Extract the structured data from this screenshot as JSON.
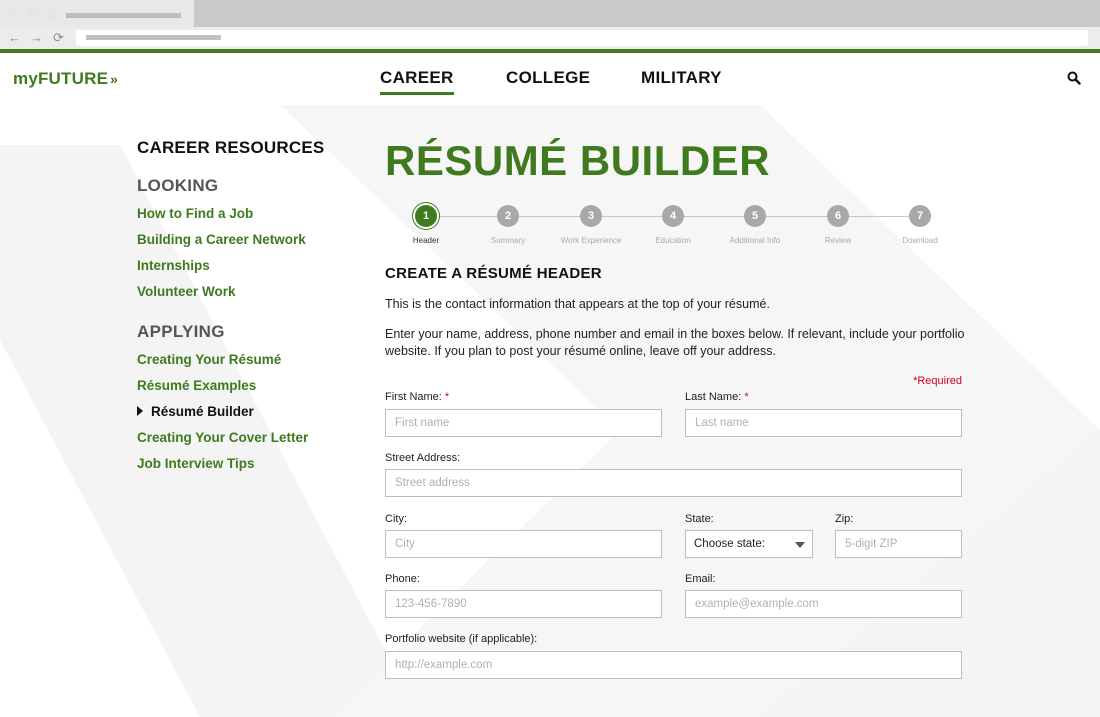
{
  "header": {
    "logo": "myFUTURE",
    "nav": [
      "CAREER",
      "COLLEGE",
      "MILITARY"
    ],
    "active_nav": "CAREER"
  },
  "sidebar": {
    "title": "CAREER RESOURCES",
    "sections": [
      {
        "heading": "LOOKING",
        "links": [
          "How to Find a Job",
          "Building a Career Network",
          "Internships",
          "Volunteer Work"
        ]
      },
      {
        "heading": "APPLYING",
        "links": [
          "Creating Your Résumé",
          "Résumé Examples",
          "Résumé Builder",
          "Creating Your Cover Letter",
          "Job Interview Tips"
        ]
      }
    ],
    "current": "Résumé Builder"
  },
  "main": {
    "title": "RÉSUMÉ BUILDER",
    "steps": [
      {
        "num": "1",
        "label": "Header"
      },
      {
        "num": "2",
        "label": "Summary"
      },
      {
        "num": "3",
        "label": "Work Experience"
      },
      {
        "num": "4",
        "label": "Education"
      },
      {
        "num": "5",
        "label": "Additional Info"
      },
      {
        "num": "6",
        "label": "Review"
      },
      {
        "num": "7",
        "label": "Download"
      }
    ],
    "active_step": 1,
    "section_heading": "CREATE A RÉSUMÉ HEADER",
    "intro1": "This is the contact information that appears at the top of your résumé.",
    "intro2_line1": "Enter your name, address, phone number and email in the boxes below. If relevant, include your portfolio",
    "intro2_line2": "website. If you plan to post your résumé online, leave off your address.",
    "required_note": "*Required"
  },
  "form": {
    "first_name": {
      "label": "First Name:",
      "required": "*",
      "placeholder": "First name",
      "value": ""
    },
    "last_name": {
      "label": "Last Name:",
      "required": "*",
      "placeholder": "Last name",
      "value": ""
    },
    "street": {
      "label": "Street Address:",
      "placeholder": "Street address",
      "value": ""
    },
    "city": {
      "label": "City:",
      "placeholder": "City",
      "value": ""
    },
    "state": {
      "label": "State:",
      "selected": "Choose state:"
    },
    "zip": {
      "label": "Zip:",
      "placeholder": "5-digit ZIP",
      "value": ""
    },
    "phone": {
      "label": "Phone:",
      "placeholder": "123-456-7890",
      "value": ""
    },
    "email": {
      "label": "Email:",
      "placeholder": "example@example.com",
      "value": ""
    },
    "portfolio": {
      "label": "Portfolio website (if applicable):",
      "placeholder": "http://example.com",
      "value": ""
    }
  },
  "colors": {
    "brand": "#3f7a1f",
    "required": "#d0021b",
    "step_inactive": "#a8a8a8"
  },
  "icons": {
    "search": "search-icon",
    "back": "arrow-left-icon",
    "forward": "arrow-right-icon",
    "reload": "reload-icon"
  }
}
